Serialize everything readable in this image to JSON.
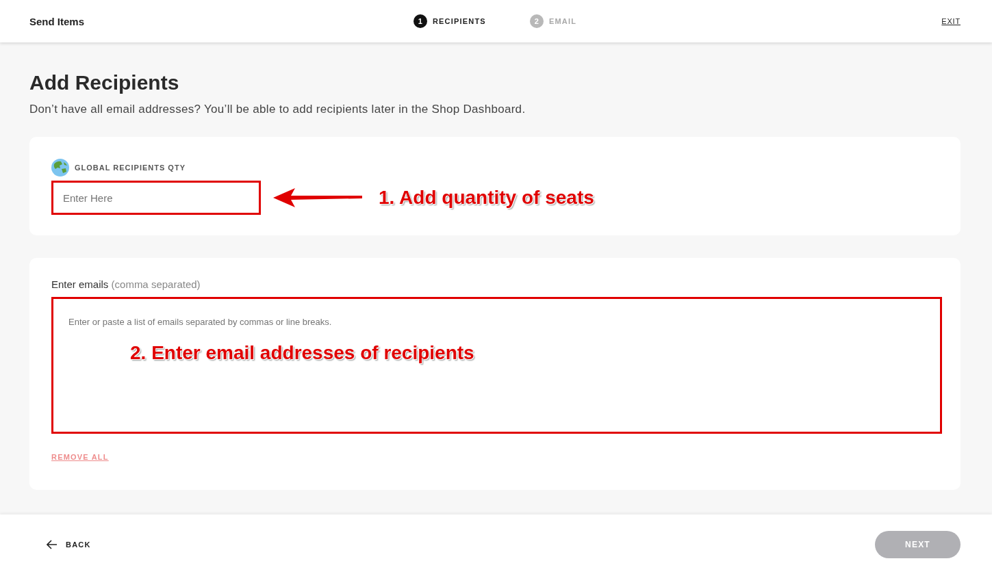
{
  "header": {
    "title": "Send Items",
    "steps": [
      {
        "number": "1",
        "label": "RECIPIENTS",
        "selected": true
      },
      {
        "number": "2",
        "label": "EMAIL",
        "selected": false
      }
    ],
    "exit": "EXIT"
  },
  "page": {
    "heading": "Add Recipients",
    "subtitle": "Don’t have all email addresses? You’ll be able to add recipients later in the Shop Dashboard."
  },
  "quantity_card": {
    "label": "GLOBAL RECIPIENTS QTY",
    "placeholder": "Enter Here",
    "highlighted": true,
    "callout": "1. Add quantity of seats"
  },
  "emails_card": {
    "label": "Enter emails",
    "hint": "(comma separated)",
    "placeholder": "Enter or paste a list of emails separated by commas or line breaks.",
    "highlighted": true,
    "callout": "2. Enter email addresses of recipients",
    "remove_all": "REMOVE ALL"
  },
  "footer": {
    "back": "BACK",
    "next": {
      "label": "NEXT",
      "disabled": true
    }
  }
}
